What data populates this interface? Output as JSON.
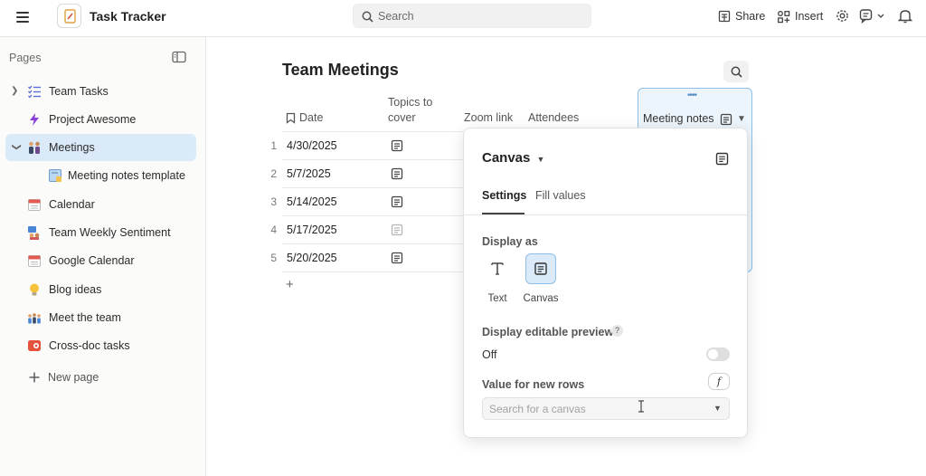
{
  "topbar": {
    "app_title": "Task Tracker",
    "search_placeholder": "Search",
    "share_label": "Share",
    "insert_label": "Insert"
  },
  "sidebar": {
    "pages_label": "Pages",
    "items": [
      {
        "label": "Team Tasks",
        "icon": "checklist-icon"
      },
      {
        "label": "Project Awesome",
        "icon": "lightning-icon"
      },
      {
        "label": "Meetings",
        "icon": "people-icon"
      },
      {
        "label": "Meeting notes template",
        "icon": "notes-template-icon"
      },
      {
        "label": "Calendar",
        "icon": "calendar-icon"
      },
      {
        "label": "Team Weekly Sentiment",
        "icon": "sentiment-icon"
      },
      {
        "label": "Google Calendar",
        "icon": "calendar-icon"
      },
      {
        "label": "Blog ideas",
        "icon": "lightbulb-icon"
      },
      {
        "label": "Meet the team",
        "icon": "team-icon"
      },
      {
        "label": "Cross-doc tasks",
        "icon": "cross-doc-icon"
      }
    ],
    "new_page_label": "New page"
  },
  "main": {
    "title": "Team Meetings",
    "columns": {
      "date": "Date",
      "topics_line1": "Topics to",
      "topics_line2": "cover",
      "zoom": "Zoom link",
      "attendees": "Attendees",
      "meeting_notes": "Meeting notes"
    },
    "rows": [
      {
        "num": "1",
        "date": "4/30/2025"
      },
      {
        "num": "2",
        "date": "5/7/2025"
      },
      {
        "num": "3",
        "date": "5/14/2025"
      },
      {
        "num": "4",
        "date": "5/17/2025"
      },
      {
        "num": "5",
        "date": "5/20/2025"
      }
    ],
    "add_row_label": "+"
  },
  "popup": {
    "title": "Canvas",
    "tabs": [
      "Settings",
      "Fill values"
    ],
    "display_as_label": "Display as",
    "option_text": "Text",
    "option_canvas": "Canvas",
    "editable_preview_label": "Display editable preview",
    "help_mark": "?",
    "toggle_state": "Off",
    "value_new_rows_label": "Value for new rows",
    "formula_glyph": "f",
    "canvas_search_placeholder": "Search for a canvas"
  },
  "colors": {
    "accent": "#8dbfe9",
    "selected_bg": "#dbeaf8"
  }
}
